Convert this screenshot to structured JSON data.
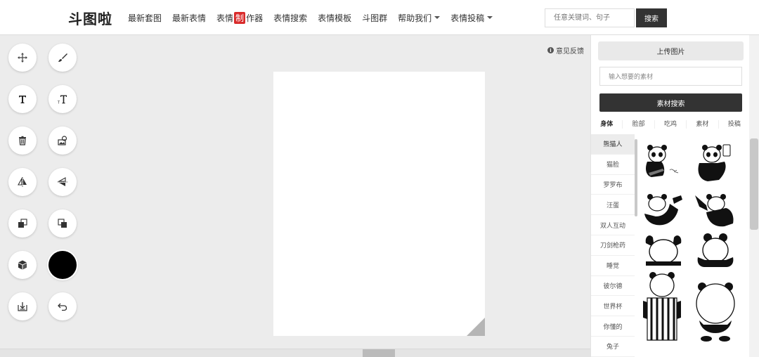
{
  "logo": "斗图啦",
  "nav": {
    "items": [
      {
        "label": "最新套图"
      },
      {
        "label": "最新表情"
      },
      {
        "label_pre": "表情",
        "label_badge": "制",
        "label_post": "作器"
      },
      {
        "label": "表情搜索"
      },
      {
        "label": "表情模板"
      },
      {
        "label": "斗图群"
      },
      {
        "label": "帮助我们",
        "dropdown": true
      },
      {
        "label": "表情投稿",
        "dropdown": true
      }
    ]
  },
  "search": {
    "placeholder": "任意关键词、句子",
    "button": "搜索"
  },
  "feedback": "意见反馈",
  "tools": [
    {
      "name": "move-icon"
    },
    {
      "name": "brush-icon"
    },
    {
      "name": "text-icon"
    },
    {
      "name": "text-style-icon"
    },
    {
      "name": "trash-icon"
    },
    {
      "name": "image-edit-icon"
    },
    {
      "name": "flip-horizontal-icon"
    },
    {
      "name": "flip-vertical-icon"
    },
    {
      "name": "bring-forward-icon"
    },
    {
      "name": "send-backward-icon"
    },
    {
      "name": "cube-icon"
    },
    {
      "name": "color-swatch"
    },
    {
      "name": "download-icon"
    },
    {
      "name": "undo-icon"
    }
  ],
  "colors": {
    "current_color": "#000000",
    "accent_badge": "#d92b2b"
  },
  "panel": {
    "upload": "上传图片",
    "material_placeholder": "输入想要的素材",
    "material_search": "素材搜索",
    "tabs": [
      "身体",
      "脸部",
      "吃鸡",
      "素材",
      "投稿"
    ],
    "active_tab": "身体",
    "sub_items": [
      "熊猫人",
      "猫脸",
      "罗罗布",
      "汪蛋",
      "双人互动",
      "刀剑枪药",
      "睡觉",
      "彼尔德",
      "世界杯",
      "你懂的",
      "兔子"
    ],
    "active_sub": "熊猫人"
  }
}
